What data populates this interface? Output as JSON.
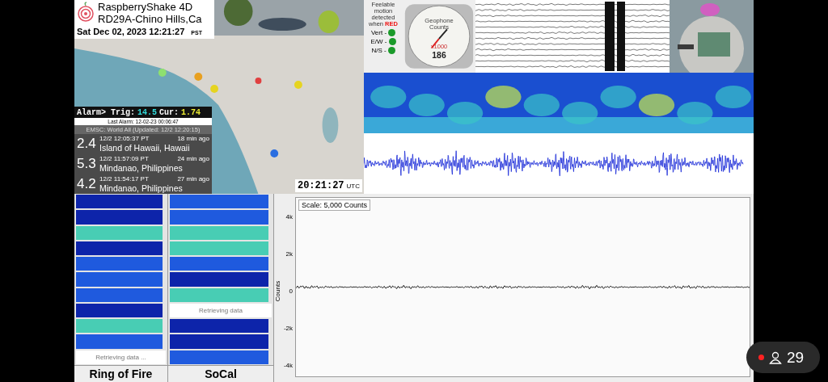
{
  "station": {
    "brand": "RaspberryShake 4D",
    "name": "RD29A-Chino Hills,Ca",
    "datetime": "Sat Dec 02, 2023 12:21:27",
    "tz": "PST"
  },
  "alarm": {
    "prefix": "Alarm> Trig:",
    "trig": "14.5",
    "cur_label": "Cur:",
    "cur": "1.74"
  },
  "last_alarm": "Last Alarm: 12-02-23 00:06:47",
  "quakes": {
    "header": "EMSC: World All (Updated: 12/2 12:20:15)",
    "items": [
      {
        "mag": "2.4",
        "time": "12/2 12:05:37 PT",
        "age": "18 min ago",
        "place": "Island of Hawaii, Hawaii"
      },
      {
        "mag": "5.3",
        "time": "12/2 11:57:09 PT",
        "age": "24 min ago",
        "place": "Mindanao, Philippines"
      },
      {
        "mag": "4.2",
        "time": "12/2 11:54:17 PT",
        "age": "27 min ago",
        "place": "Mindanao, Philippines"
      }
    ]
  },
  "utc_clock": {
    "time": "20:21:27",
    "tz": "UTC"
  },
  "motion": {
    "note": "Feelable motion detected when",
    "alert": "RED",
    "channels": [
      {
        "label": "Vert -",
        "triggered": false
      },
      {
        "label": "E/W -",
        "triggered": false
      },
      {
        "label": "N/S -",
        "triggered": false
      }
    ]
  },
  "gauge": {
    "title": "Geophone",
    "unit": "Counts",
    "multiplier": "x1000",
    "reading": "186"
  },
  "strips": [
    {
      "title": "Ring of Fire",
      "items": [
        {
          "kind": "spectrogram",
          "color": "#0d24aa"
        },
        {
          "kind": "spectrogram",
          "color": "#0d24aa"
        },
        {
          "kind": "spectrogram",
          "color": "#48cdb4"
        },
        {
          "kind": "spectrogram",
          "color": "#0d24aa"
        },
        {
          "kind": "spectrogram",
          "color": "#1f5ade"
        },
        {
          "kind": "spectrogram",
          "color": "#1f5ade"
        },
        {
          "kind": "spectrogram",
          "color": "#1f5ade"
        },
        {
          "kind": "spectrogram",
          "color": "#0d24aa"
        },
        {
          "kind": "spectrogram",
          "color": "#48cdb4"
        },
        {
          "kind": "spectrogram",
          "color": "#1f5ade"
        },
        {
          "kind": "loading",
          "text": "Retrieving data ..."
        }
      ]
    },
    {
      "title": "SoCal",
      "items": [
        {
          "kind": "spectrogram",
          "color": "#1f5ade"
        },
        {
          "kind": "spectrogram",
          "color": "#1f5ade"
        },
        {
          "kind": "spectrogram",
          "color": "#48cdb4"
        },
        {
          "kind": "spectrogram",
          "color": "#48cdb4"
        },
        {
          "kind": "spectrogram",
          "color": "#1f5ade"
        },
        {
          "kind": "spectrogram",
          "color": "#0d24aa"
        },
        {
          "kind": "spectrogram",
          "color": "#48cdb4"
        },
        {
          "kind": "loading",
          "text": "Retrieving data"
        },
        {
          "kind": "spectrogram",
          "color": "#0d24aa"
        },
        {
          "kind": "spectrogram",
          "color": "#0d24aa"
        },
        {
          "kind": "spectrogram",
          "color": "#1f5ade"
        }
      ]
    }
  ],
  "chart": {
    "scale": "Scale: 5,000 Counts",
    "ylabel": "Counts",
    "yticks": [
      "4k",
      "2k",
      "0",
      "-2k",
      "-4k"
    ]
  },
  "viewers": {
    "live": true,
    "count": "29"
  }
}
